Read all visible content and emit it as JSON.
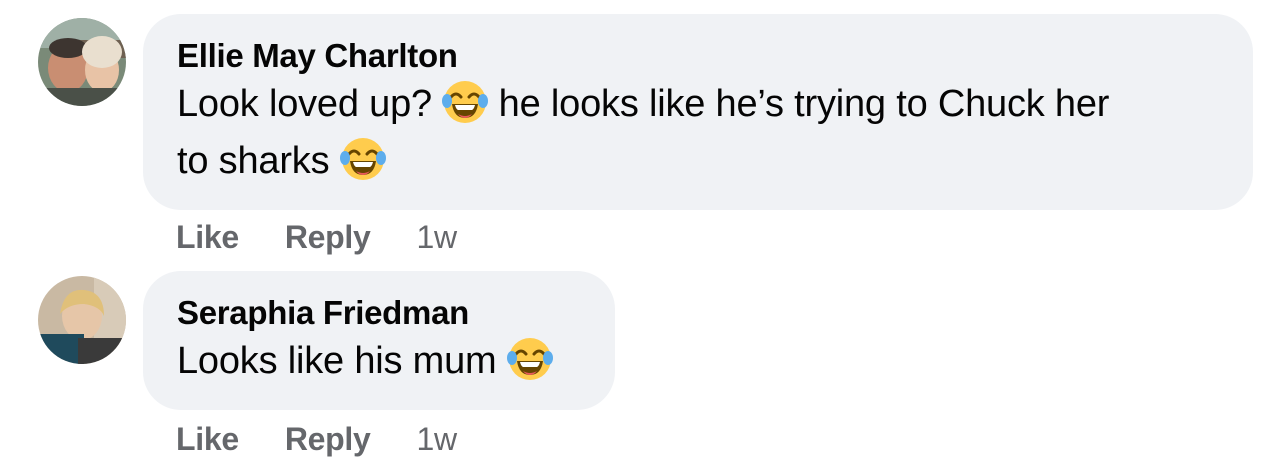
{
  "comments": [
    {
      "author": "Ellie May Charlton",
      "lines": [
        {
          "before": "Look loved up? ",
          "emoji": "face-with-tears-of-joy",
          "after": " he looks like he’s trying to Chuck her"
        },
        {
          "before": "to sharks ",
          "emoji": "face-with-tears-of-joy",
          "after": ""
        }
      ],
      "actions": {
        "like": "Like",
        "reply": "Reply",
        "time": "1w"
      }
    },
    {
      "author": "Seraphia Friedman",
      "lines": [
        {
          "before": "Looks like his mum ",
          "emoji": "face-with-tears-of-joy",
          "after": ""
        }
      ],
      "actions": {
        "like": "Like",
        "reply": "Reply",
        "time": "1w"
      }
    }
  ],
  "colors": {
    "bubble": "#f0f2f5",
    "text": "#050505",
    "secondary": "#65676b",
    "emoji_face": "#ffcc4d",
    "emoji_tears": "#5dadec"
  }
}
